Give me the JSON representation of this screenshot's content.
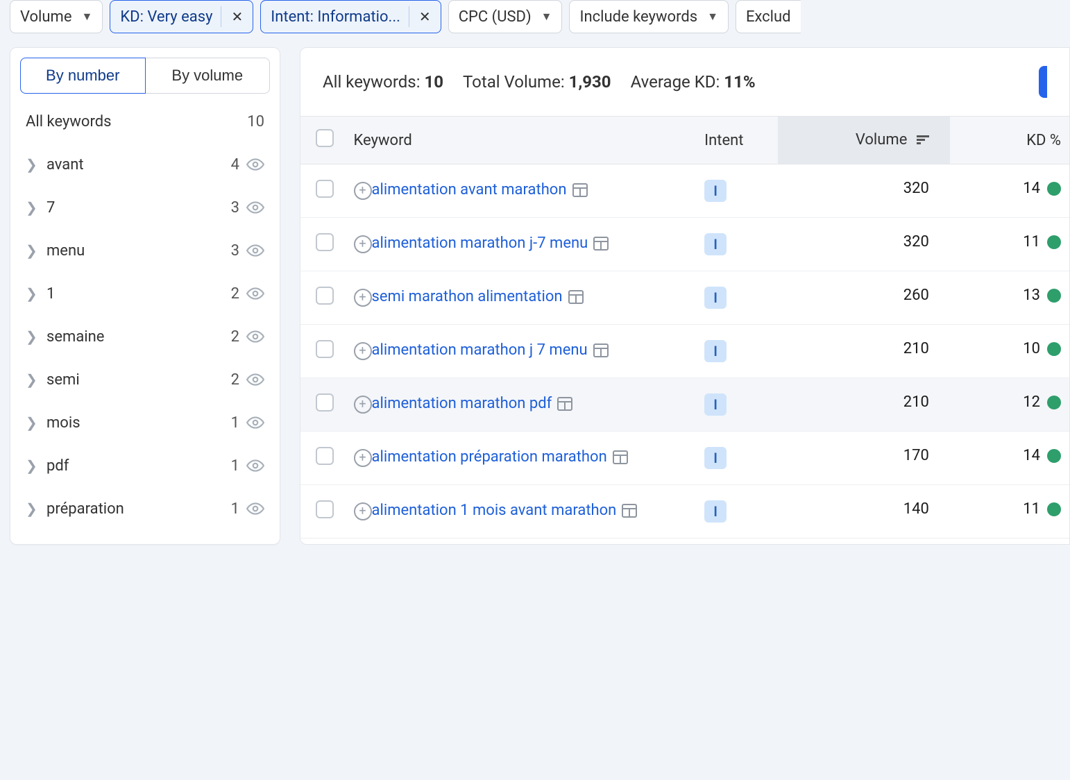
{
  "filters": {
    "volume": "Volume",
    "kd": "KD: Very easy",
    "intent": "Intent: Informatio...",
    "cpc": "CPC (USD)",
    "include": "Include keywords",
    "exclude": "Exclud"
  },
  "sidebar": {
    "tab_number": "By number",
    "tab_volume": "By volume",
    "all_label": "All keywords",
    "all_count": "10",
    "groups": [
      {
        "label": "avant",
        "count": "4"
      },
      {
        "label": "7",
        "count": "3"
      },
      {
        "label": "menu",
        "count": "3"
      },
      {
        "label": "1",
        "count": "2"
      },
      {
        "label": "semaine",
        "count": "2"
      },
      {
        "label": "semi",
        "count": "2"
      },
      {
        "label": "mois",
        "count": "1"
      },
      {
        "label": "pdf",
        "count": "1"
      },
      {
        "label": "préparation",
        "count": "1"
      }
    ]
  },
  "stats": {
    "all_label": "All keywords:",
    "all_value": "10",
    "volume_label": "Total Volume:",
    "volume_value": "1,930",
    "kd_label": "Average KD:",
    "kd_value": "11%"
  },
  "columns": {
    "keyword": "Keyword",
    "intent": "Intent",
    "volume": "Volume",
    "kd": "KD %"
  },
  "rows": [
    {
      "keyword": "alimentation avant marathon",
      "intent": "I",
      "volume": "320",
      "kd": "14"
    },
    {
      "keyword": "alimentation marathon j-7 menu",
      "intent": "I",
      "volume": "320",
      "kd": "11"
    },
    {
      "keyword": "semi marathon alimentation",
      "intent": "I",
      "volume": "260",
      "kd": "13"
    },
    {
      "keyword": "alimentation marathon j 7 menu",
      "intent": "I",
      "volume": "210",
      "kd": "10"
    },
    {
      "keyword": "alimentation marathon pdf",
      "intent": "I",
      "volume": "210",
      "kd": "12",
      "hovered": true
    },
    {
      "keyword": "alimentation préparation marathon",
      "intent": "I",
      "volume": "170",
      "kd": "14"
    },
    {
      "keyword": "alimentation 1 mois avant marathon",
      "intent": "I",
      "volume": "140",
      "kd": "11"
    }
  ]
}
